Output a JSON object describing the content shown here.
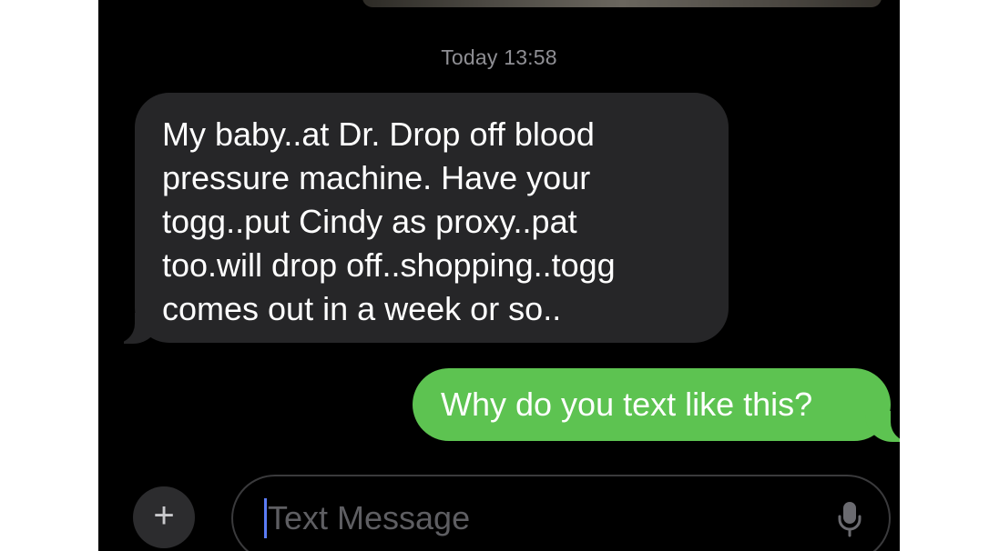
{
  "conversation": {
    "timestamp": "Today 13:58",
    "incoming_message": {
      "lines": [
        "My baby..at Dr. Drop off blood",
        "pressure machine. Have your",
        "togg..put Cindy as proxy..pat",
        "too.will drop off..shopping..togg",
        "comes out in a week or so.."
      ]
    },
    "outgoing_message": {
      "text": "Why do you text like this?"
    }
  },
  "composer": {
    "add_label": "+",
    "placeholder": "Text Message",
    "mic_icon": "microphone-icon"
  },
  "colors": {
    "background": "#000000",
    "incoming_bubble": "#262628",
    "outgoing_bubble": "#5dc351",
    "cursor": "#5b7cf5"
  }
}
